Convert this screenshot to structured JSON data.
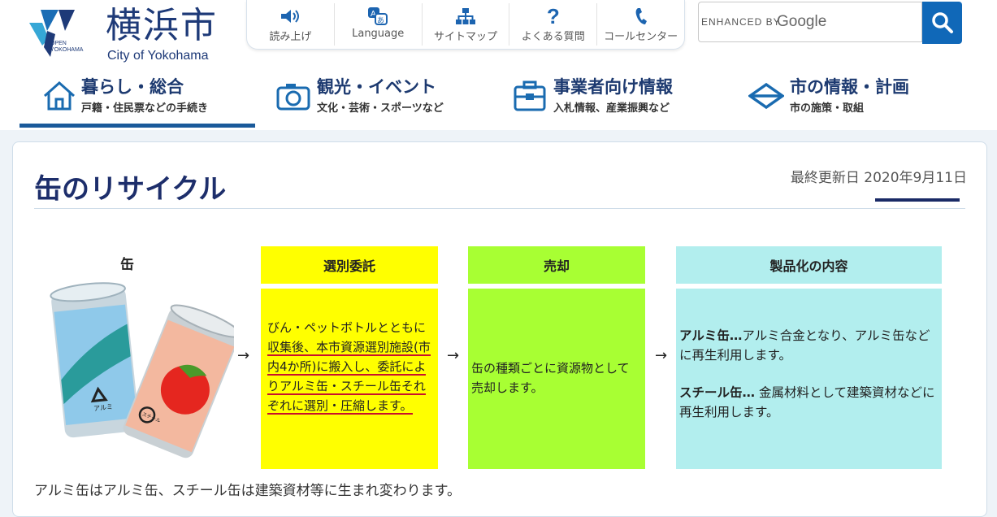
{
  "header": {
    "logo": {
      "city_jp": "横浜市",
      "city_en": "City of Yokohama",
      "open_text": "OPEN YOKOHAMA"
    },
    "utility": [
      {
        "label": "読み上げ",
        "icon": "speaker-icon"
      },
      {
        "label": "Language",
        "icon": "language-icon"
      },
      {
        "label": "サイトマップ",
        "icon": "sitemap-icon"
      },
      {
        "label": "よくある質問",
        "icon": "question-icon"
      },
      {
        "label": "コールセンター",
        "icon": "phone-icon"
      }
    ],
    "search": {
      "enhanced_by": "ENHANCED BY",
      "google": "Google",
      "button_icon": "search-icon"
    }
  },
  "nav": [
    {
      "title": "暮らし・総合",
      "sub": "戸籍・住民票などの手続き",
      "icon": "house-icon",
      "active": true
    },
    {
      "title": "観光・イベント",
      "sub": "文化・芸術・スポーツなど",
      "icon": "camera-icon",
      "active": false
    },
    {
      "title": "事業者向け情報",
      "sub": "入札情報、産業振興など",
      "icon": "briefcase-icon",
      "active": false
    },
    {
      "title": "市の情報・計画",
      "sub": "市の施策・取組",
      "icon": "city-emblem-icon",
      "active": false
    }
  ],
  "page": {
    "title": "缶のリサイクル",
    "updated": "最終更新日 2020年9月11日",
    "can_label": "缶",
    "can_marks": [
      "アルミ",
      "スチール"
    ],
    "arrow": "→",
    "columns": [
      {
        "header": "選別委託",
        "header_color": "#ffff00",
        "body_color": "#ffff00",
        "intro": "びん・ペットボトルとともに",
        "underlined": "収集後、本市資源選別施設(市内4か所)に搬入し、委託によりアルミ缶・スチール缶それぞれに選別・圧縮します。"
      },
      {
        "header": "売却",
        "header_color": "#a8ff33",
        "body_color": "#a8ff33",
        "text": "缶の種類ごとに資源物として売却します。"
      },
      {
        "header": "製品化の内容",
        "header_color": "#b2eeee",
        "body_color": "#b2eeee",
        "alu_bold": "アルミ缶…",
        "alu_text": "アルミ合金となり、アルミ缶などに再生利用します。",
        "steel_bold": "スチール缶…",
        "steel_text": " 金属材料として建築資材などに再生利用します。"
      }
    ],
    "caption": "アルミ缶はアルミ缶、スチール缶は建築資材等に生まれ変わります。"
  }
}
